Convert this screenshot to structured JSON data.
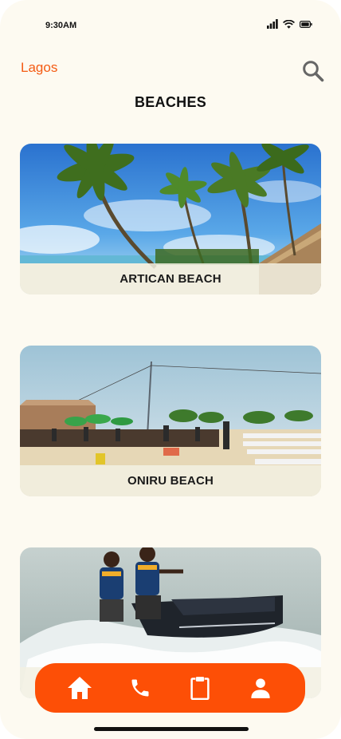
{
  "status_bar": {
    "time": "9:30AM"
  },
  "header": {
    "location": "Lagos",
    "title": "BEACHES"
  },
  "beaches": [
    {
      "name": "ARTICAN BEACH"
    },
    {
      "name": "ONIRU BEACH"
    },
    {
      "name": ""
    }
  ],
  "nav": {
    "items": [
      {
        "icon": "home-icon"
      },
      {
        "icon": "phone-icon"
      },
      {
        "icon": "clipboard-icon"
      },
      {
        "icon": "person-icon"
      }
    ]
  },
  "colors": {
    "accent": "#fd4f06",
    "location_text": "#f45b13",
    "background": "#fdfaf1"
  }
}
